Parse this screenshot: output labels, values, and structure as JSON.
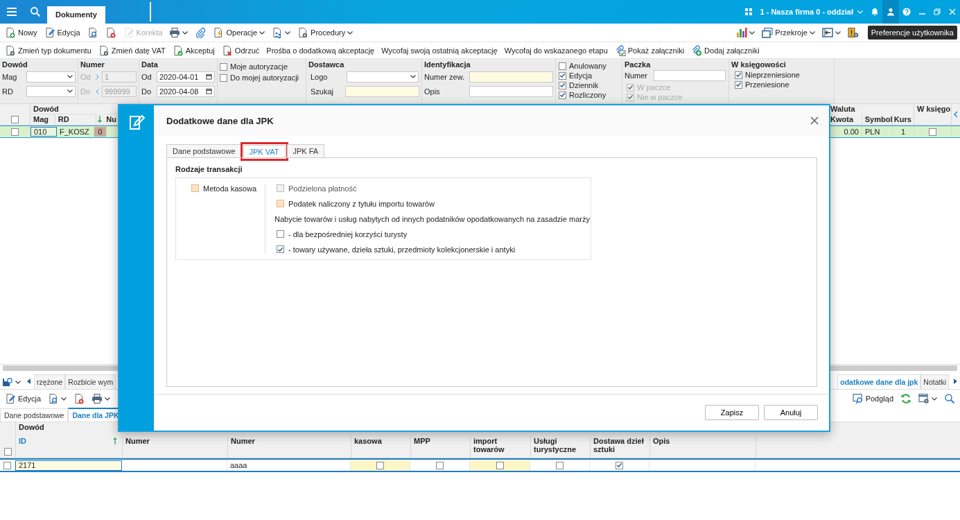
{
  "top_bar": {
    "tab": "Dokumenty",
    "company": "1 - Nasza firma 0 - oddział"
  },
  "toolbar": [
    {
      "label": "Nowy",
      "dropdown": false,
      "disabled": false
    },
    {
      "label": "Edycja",
      "dropdown": false,
      "disabled": false
    },
    {
      "dropdown": false,
      "disabled": false
    },
    {
      "dropdown": false,
      "disabled": false
    },
    {
      "label": "Korekta",
      "dropdown": false,
      "disabled": true
    },
    {
      "dropdown": true,
      "disabled": false
    },
    {
      "dropdown": false,
      "disabled": false
    },
    {
      "label": "Operacje",
      "dropdown": true,
      "disabled": false
    },
    {
      "dropdown": true,
      "disabled": false
    },
    {
      "label": "Procedury",
      "dropdown": true,
      "disabled": false
    }
  ],
  "toolbar_right": [
    {
      "dropdown": true
    },
    {
      "label": "Przekroje",
      "dropdown": true
    },
    {
      "dropdown": true
    },
    {
      "dropdown": false
    }
  ],
  "tooltip": "Preferencje użytkownika",
  "actions": [
    "Zmień typ dokumentu",
    "Zmień datę VAT",
    "Akceptuj",
    "Odrzuć",
    "Prośba o dodatkową akceptację",
    "Wycofaj swoją ostatnią akceptację",
    "Wycofaj do wskazanego etapu",
    "Pokaż załączniki",
    "Dodaj załączniki"
  ],
  "filters": {
    "dowod": {
      "title": "Dowód",
      "fields": [
        "Mag",
        "RD"
      ]
    },
    "numer": {
      "title": "Numer",
      "disabled": true,
      "from_label": "Od",
      "from": "1",
      "to_label": "Do",
      "to": "999999"
    },
    "data": {
      "title": "Data",
      "from_label": "Od",
      "from": "2020-04-01",
      "to_label": "Do",
      "to": "2020-04-08"
    },
    "authorization": [
      {
        "label": "Moje autoryzacje",
        "checked": false
      },
      {
        "label": "Do mojej autoryzacji",
        "checked": false
      }
    ],
    "dostawca": {
      "title": "Dostawca",
      "logo_label": "Logo",
      "search_label": "Szukaj"
    },
    "identyfikacja": {
      "title": "Identyfikacja",
      "number_label": "Numer zew.",
      "desc_label": "Opis"
    },
    "status": [
      {
        "label": "Anulowany",
        "checked": false
      },
      {
        "label": "Edycja",
        "checked": true
      },
      {
        "label": "Dziennik",
        "checked": true
      },
      {
        "label": "Rozliczony",
        "checked": true
      }
    ],
    "paczka": {
      "title": "Paczka",
      "number_label": "Numer",
      "options": [
        {
          "label": "W paczce",
          "checked": true,
          "disabled": true
        },
        {
          "label": "Nie w paczce",
          "checked": true,
          "disabled": true
        }
      ]
    },
    "ksiegowosc": {
      "title": "W księgowości",
      "options": [
        {
          "label": "Nieprzeniesione",
          "checked": true
        },
        {
          "label": "Przeniesione",
          "checked": true
        }
      ]
    }
  },
  "documents_grid": {
    "all_checked": false,
    "left_group": "Dowód",
    "left_columns": [
      "Mag",
      "RD",
      "Nu"
    ],
    "right_group": "Waluta",
    "right_columns": [
      "Kwota",
      "Symbol",
      "Kurs"
    ],
    "last_column": "W księgo",
    "rows": [
      {
        "selected": true,
        "checked": false,
        "mag": "010",
        "rd": "F_KOSZ",
        "count": "0",
        "kwota": "0.00",
        "symbol": "PLN",
        "kurs": "1",
        "posted": false
      }
    ]
  },
  "details": {
    "tabs": [
      {
        "label": "rzężone",
        "selected": false
      },
      {
        "label": "Rozbicie wym",
        "selected": false
      },
      {
        "label": "odatkowe dane dla jpk",
        "selected": true
      },
      {
        "label": "Notatki",
        "selected": false
      }
    ],
    "toolbar_left": [
      {
        "label": "Edycja",
        "dropdown": false
      },
      {
        "dropdown": true
      },
      {
        "dropdown": false
      },
      {
        "dropdown": true
      }
    ],
    "toolbar_right": [
      {
        "label": "Podgląd",
        "dropdown": false
      },
      {
        "dropdown": false
      },
      {
        "dropdown": true
      },
      {
        "dropdown": false
      }
    ],
    "subtabs": [
      {
        "label": "Dane podstawowe",
        "selected": false
      },
      {
        "label": "Dane dla JPK",
        "selected": true
      }
    ],
    "grid": {
      "all_checked": false,
      "group": "Dowód",
      "columns": [
        {
          "label": "ID",
          "sorted": true
        },
        {
          "label": "Numer",
          "sorted": false
        },
        {
          "label": "Numer",
          "sorted": false
        },
        {
          "label": "kasowa",
          "sorted": false
        },
        {
          "label": "MPP",
          "sorted": false
        },
        {
          "label": "import towarów",
          "sorted": false
        },
        {
          "label": "Usługi turystyczne",
          "sorted": false
        },
        {
          "label": "Dostawa dzieł sztuki",
          "sorted": false
        },
        {
          "label": "Opis",
          "sorted": false
        }
      ],
      "rows": [
        {
          "checked": false,
          "cells": [
            {
              "kind": "text",
              "value": "2171"
            },
            {
              "kind": "empty"
            },
            {
              "kind": "text",
              "value": "aaaa"
            },
            {
              "kind": "checkbox",
              "checked": false
            },
            {
              "kind": "checkbox",
              "checked": false
            },
            {
              "kind": "checkbox",
              "checked": false
            },
            {
              "kind": "checkbox",
              "checked": false
            },
            {
              "kind": "checkbox",
              "checked": true
            },
            {
              "kind": "empty"
            }
          ]
        }
      ]
    }
  },
  "dialog": {
    "title": "Dodatkowe dane dla JPK",
    "tabs": [
      {
        "label": "Dane podstawowe",
        "selected": false,
        "highlighted": false
      },
      {
        "label": "JPK VAT",
        "selected": true,
        "highlighted": true
      },
      {
        "label": "JPK FA",
        "selected": false,
        "highlighted": false
      }
    ],
    "group_title": "Rodzaje transakcji",
    "left_options": [
      {
        "kind": "checkbox",
        "label": "Metoda kasowa",
        "checked": false,
        "disabled": false,
        "marked": true
      }
    ],
    "right_options": [
      {
        "kind": "checkbox",
        "label": "Podzielona płatność",
        "checked": false,
        "disabled": true,
        "marked": false
      },
      {
        "kind": "checkbox",
        "label": "Podatek naliczony z tytułu importu towarów",
        "checked": false,
        "disabled": false,
        "marked": true
      },
      {
        "kind": "text",
        "label": "Nabycie towarów i usług nabytych od innych podatników opodatkowanych na zasadzie marży"
      },
      {
        "kind": "checkbox",
        "label": "- dla bezpośredniej korzyści turysty",
        "checked": false,
        "disabled": false,
        "marked": false
      },
      {
        "kind": "checkbox",
        "label": "- towary używane, dzieła sztuki, przedmioty kolekcjonerskie i antyki",
        "checked": true,
        "disabled": false,
        "marked": false
      }
    ],
    "buttons": [
      "Zapisz",
      "Anuluj"
    ]
  }
}
